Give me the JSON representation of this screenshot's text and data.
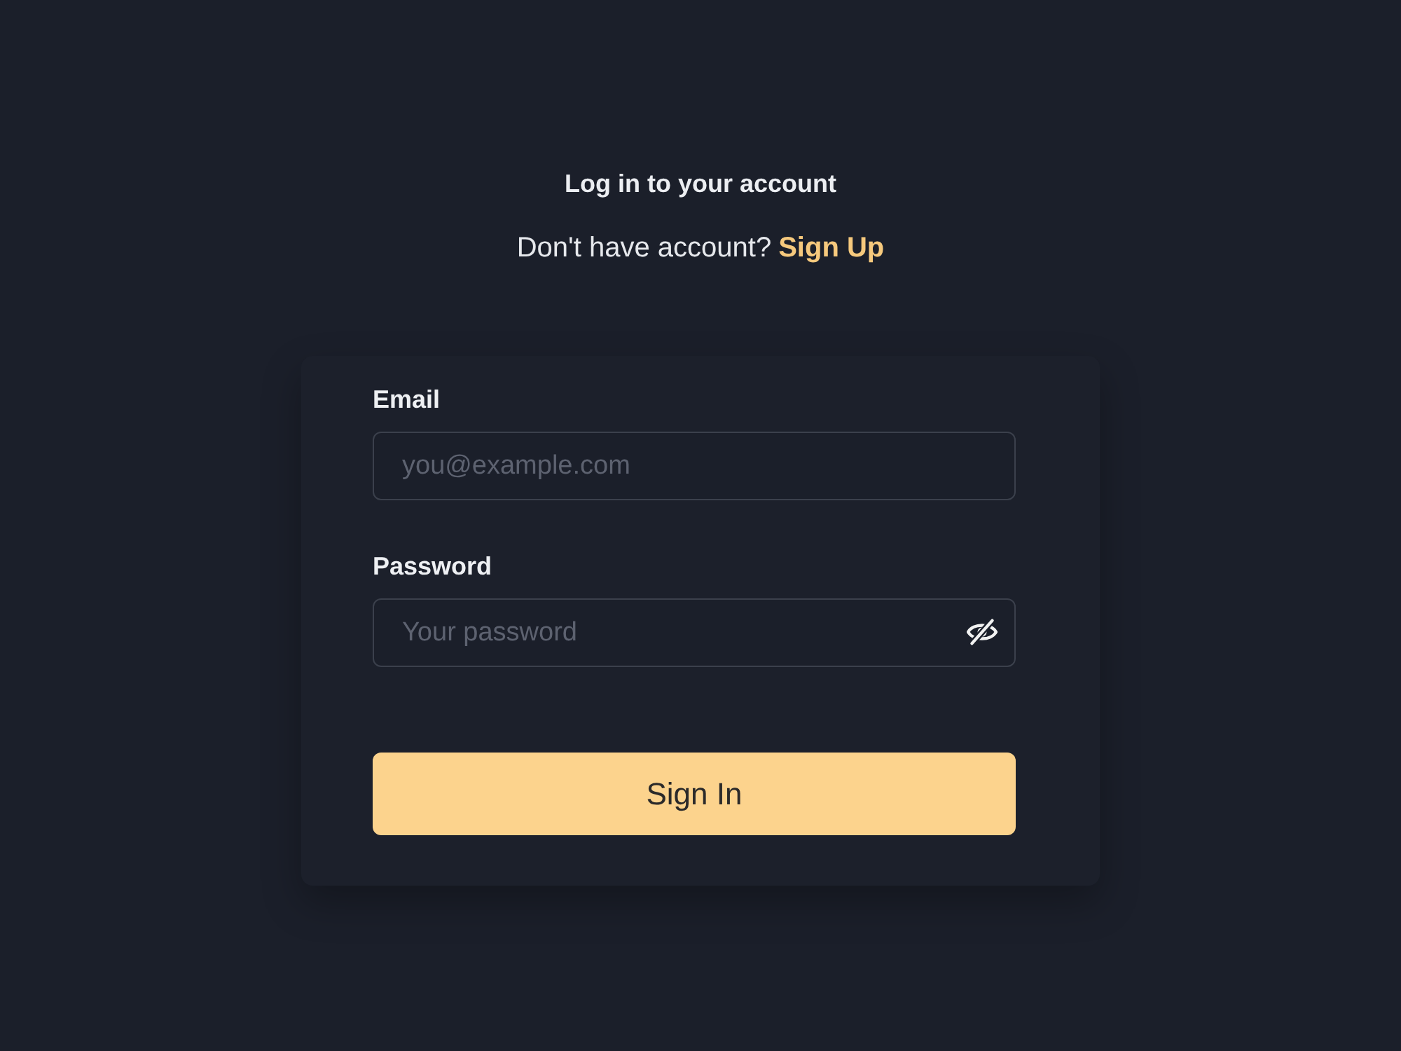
{
  "header": {
    "title": "Log in to your account",
    "prompt": "Don't have account?",
    "link": "Sign Up"
  },
  "form": {
    "fields": [
      {
        "kind": "text",
        "label": "Email",
        "placeholder": "you@example.com"
      },
      {
        "kind": "password",
        "label": "Password",
        "placeholder": "Your password",
        "revealed": false
      }
    ],
    "submit": "Sign In"
  }
}
